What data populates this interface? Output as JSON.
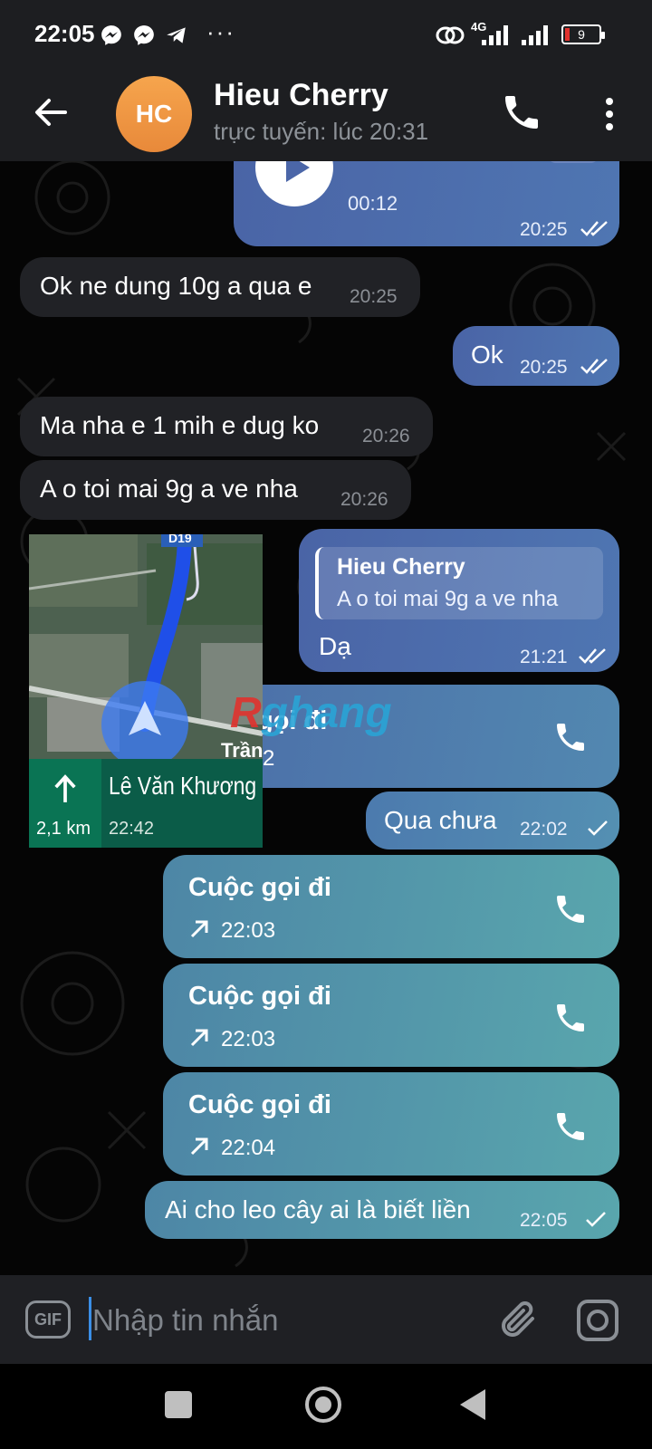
{
  "status_bar": {
    "time": "22:05",
    "more_indicator": "···",
    "network": "4G",
    "battery": "9",
    "icons": [
      "messenger-icon",
      "messenger-icon",
      "telegram-icon",
      "link-icon",
      "signal-icon",
      "signal-icon",
      "battery-icon"
    ]
  },
  "header": {
    "avatar_initials": "HC",
    "name": "Hieu Cherry",
    "status": "trực tuyến: lúc 20:31",
    "avatar_color": "#f0994a"
  },
  "messages": {
    "voice": {
      "duration": "00:12",
      "time": "20:25",
      "transcribe_label": "→A"
    },
    "m1": {
      "text": "Ok ne dung 10g a qua e",
      "time": "20:25"
    },
    "m2": {
      "text": "Ok",
      "time": "20:25"
    },
    "m3": {
      "text": "Ma nha e 1 mih e dug ko",
      "time": "20:26"
    },
    "m4": {
      "text": "A o toi mai 9g a ve nha",
      "time": "20:26"
    },
    "m5": {
      "reply_name": "Hieu Cherry",
      "reply_text": "A o toi mai 9g a ve nha",
      "text": "Dạ",
      "time": "21:21"
    },
    "map_sticker": {
      "street": "Lê Văn Khương",
      "distance": "2,1 km",
      "eta": "22:42",
      "road_label": "Trần",
      "route_sign": "D19"
    },
    "call0": {
      "title": "gọi đi",
      "time": "2"
    },
    "m6": {
      "text": "Qua chưa",
      "time": "22:02"
    },
    "call1": {
      "title": "Cuộc gọi đi",
      "time": "22:03"
    },
    "call2": {
      "title": "Cuộc gọi đi",
      "time": "22:03"
    },
    "call3": {
      "title": "Cuộc gọi đi",
      "time": "22:04"
    },
    "m7": {
      "text": "Ai cho leo cây ai là biết liền",
      "time": "22:05"
    }
  },
  "watermark": {
    "prefix": "R",
    "rest": "ghang"
  },
  "input": {
    "gif_label": "GIF",
    "placeholder": "Nhập tin nhắn"
  },
  "colors": {
    "outgoing": "#4b69ab",
    "outgoing_teal": "#56a0ac",
    "incoming": "#212226",
    "header_bg": "#1d1e21"
  }
}
